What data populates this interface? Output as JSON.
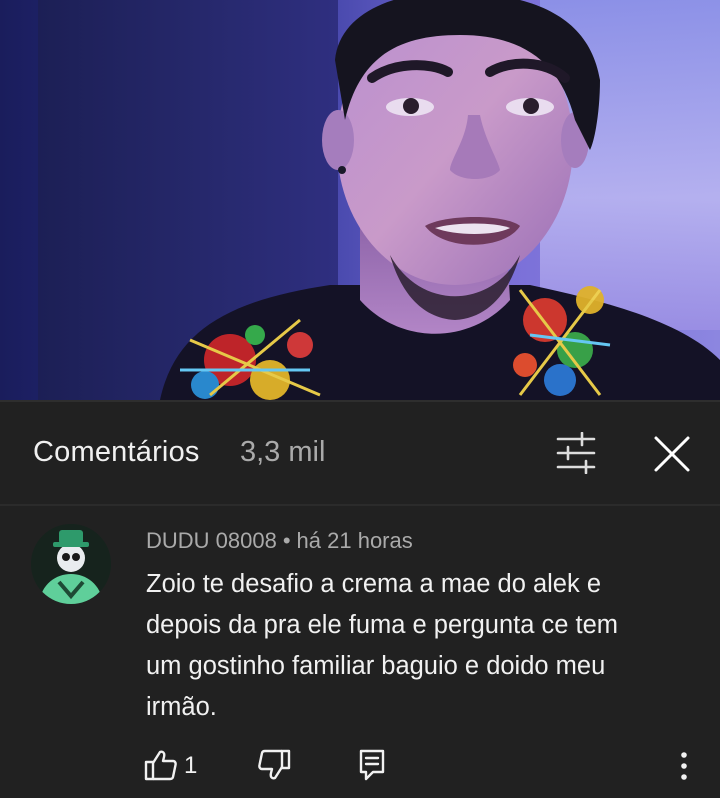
{
  "video": {
    "description_icon": "person-portrait"
  },
  "header": {
    "title": "Comentários",
    "count": "3,3 mil",
    "filter_icon": "sliders-icon",
    "close_icon": "close-icon"
  },
  "comment": {
    "author": "DUDU 08008",
    "separator": "•",
    "time": "há 21 horas",
    "lines": [
      "Zoio te desafio a crema a mae do alek e",
      "depois da pra ele fuma e pergunta ce tem",
      "um gostinho familiar baguio e doido meu",
      "irmão."
    ],
    "like_count": "1"
  },
  "colors": {
    "background": "#212121",
    "text_primary": "#f1f1f1",
    "text_secondary": "#aaaaaa"
  }
}
